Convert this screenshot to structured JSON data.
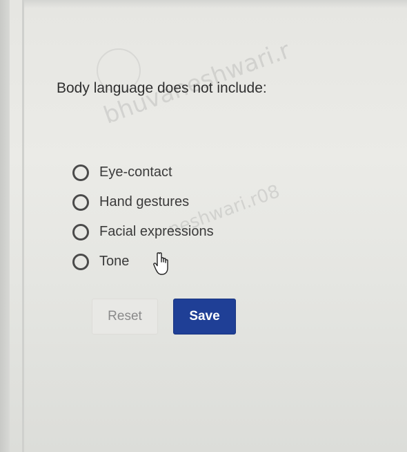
{
  "question": {
    "text": "Body language does not include:"
  },
  "options": [
    {
      "label": "Eye-contact",
      "selected": false
    },
    {
      "label": "Hand gestures",
      "selected": false
    },
    {
      "label": "Facial expressions",
      "selected": false
    },
    {
      "label": "Tone",
      "selected": false
    }
  ],
  "buttons": {
    "reset_label": "Reset",
    "save_label": "Save"
  },
  "watermark": {
    "line1": "bhuvaneshwari.r",
    "line2": "neshwari.r08"
  },
  "colors": {
    "save_background": "#1f3f96",
    "save_text": "#ffffff",
    "reset_text": "#8a8a8a",
    "radio_border": "#4a4a4a"
  },
  "icons": {
    "cursor": "hand-pointer-icon"
  }
}
